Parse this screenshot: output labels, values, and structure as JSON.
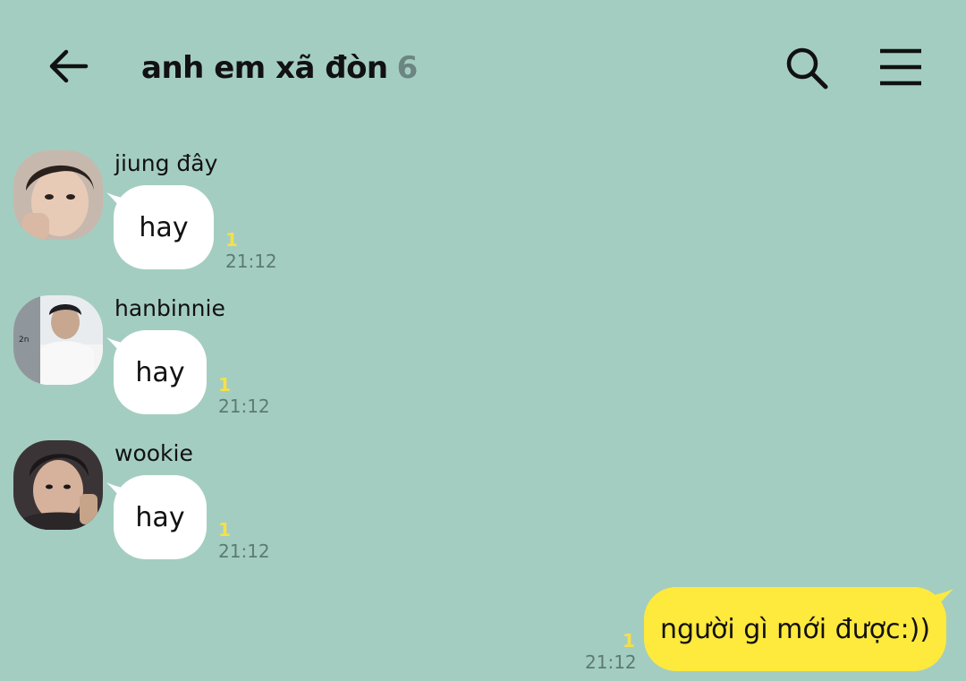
{
  "header": {
    "title": "anh em xã đòn",
    "member_count": "6",
    "back_icon": "arrow-left-icon",
    "search_icon": "search-icon",
    "menu_icon": "hamburger-menu-icon"
  },
  "messages": [
    {
      "sender": "jiung đây",
      "text": "hay",
      "unread": "1",
      "time": "21:12"
    },
    {
      "sender": "hanbinnie",
      "text": "hay",
      "unread": "1",
      "time": "21:12"
    },
    {
      "sender": "wookie",
      "text": "hay",
      "unread": "1",
      "time": "21:12"
    }
  ],
  "own_message": {
    "text": "người gì mới được:))",
    "unread": "1",
    "time": "21:12"
  },
  "colors": {
    "background": "#a4cdc1",
    "own_bubble": "#fee93d",
    "other_bubble": "#ffffff",
    "unread": "#f5e04a",
    "timestamp": "#5c7a74",
    "member_count": "#6b8580"
  }
}
